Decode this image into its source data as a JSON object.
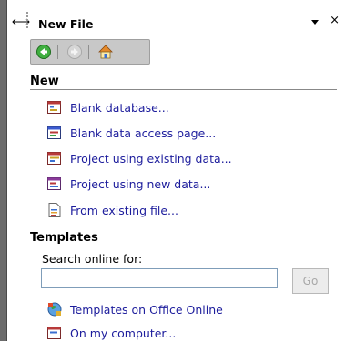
{
  "pane": {
    "title": "New File",
    "close_glyph": "×"
  },
  "sections": {
    "new_title": "New",
    "templates_title": "Templates"
  },
  "new_items": [
    {
      "label": "Blank database...",
      "icon": "blank-database-icon"
    },
    {
      "label": "Blank data access page...",
      "icon": "data-access-page-icon"
    },
    {
      "label": "Project using existing data...",
      "icon": "project-existing-data-icon"
    },
    {
      "label": "Project using new data...",
      "icon": "project-new-data-icon"
    },
    {
      "label": "From existing file...",
      "icon": "existing-file-icon"
    }
  ],
  "search": {
    "label": "Search online for:",
    "value": "",
    "go_label": "Go"
  },
  "template_items": [
    {
      "label": "Templates on Office Online",
      "icon": "office-online-icon"
    },
    {
      "label": "On my computer...",
      "icon": "my-computer-icon"
    }
  ]
}
